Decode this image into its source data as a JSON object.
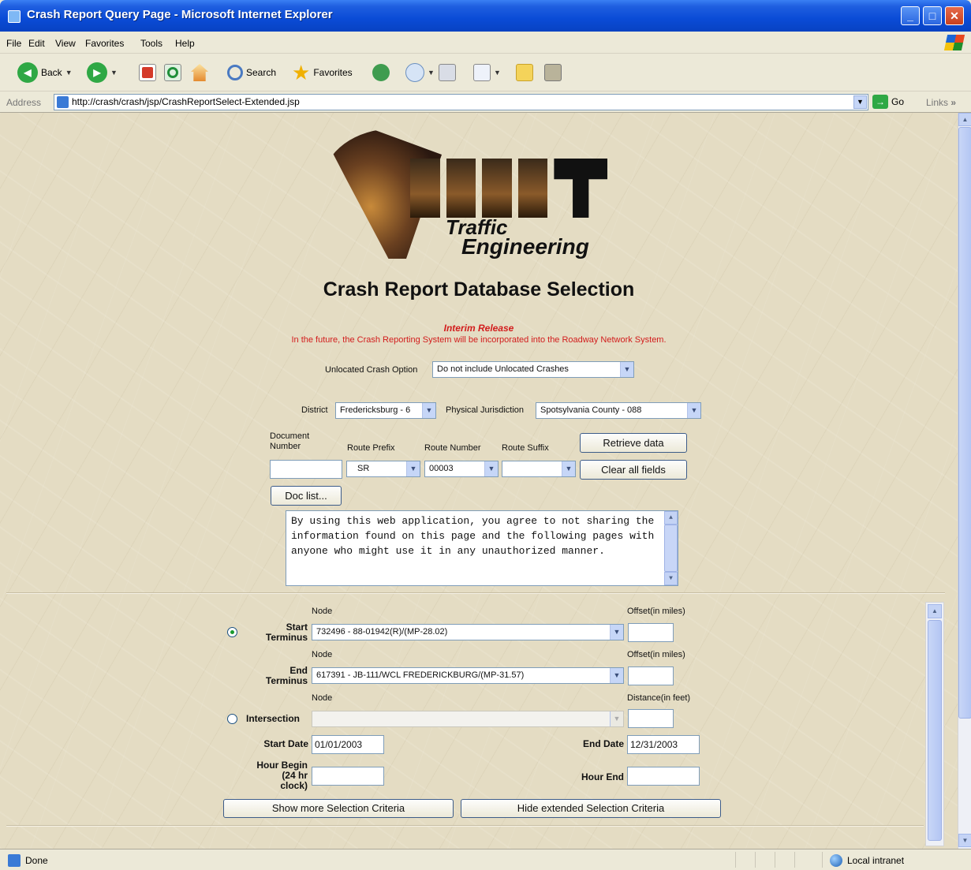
{
  "window": {
    "title": "Crash Report Query Page - Microsoft Internet Explorer",
    "controls": [
      "_",
      "□",
      "✕"
    ]
  },
  "menu": [
    "File",
    "Edit",
    "View",
    "Favorites",
    "Tools",
    "Help"
  ],
  "toolbar": {
    "back_label": "Back",
    "search_label": "Search",
    "favorites_label": "Favorites"
  },
  "address": {
    "label": "Address",
    "url": "http://crash/crash/jsp/CrashReportSelect-Extended.jsp",
    "go_label": "Go",
    "links_label": "Links",
    "more": "»"
  },
  "logo": {
    "line1": "Traffic",
    "line2": "Engineering"
  },
  "page": {
    "title": "Crash Report Database Selection",
    "interim": "Interim Release",
    "notice": "In the future, the Crash Reporting System will be incorporated into the Roadway Network System."
  },
  "unlocated": {
    "label": "Unlocated Crash Option",
    "value": "Do not include Unlocated Crashes"
  },
  "district": {
    "label": "District",
    "value": "Fredericksburg - 6"
  },
  "jurisdiction": {
    "label": "Physical Jurisdiction",
    "value": "Spotsylvania County - 088"
  },
  "route": {
    "document_label": "Document Number",
    "document_value": "",
    "prefix_label": "Route Prefix",
    "prefix_value": "SR",
    "number_label": "Route Number",
    "number_value": "00003",
    "suffix_label": "Route Suffix",
    "suffix_value": ""
  },
  "buttons": {
    "retrieve": "Retrieve data",
    "clear": "Clear all fields",
    "doc_list": "Doc list...",
    "show_more": "Show more Selection Criteria",
    "hide_extended": "Hide extended Selection Criteria"
  },
  "agreement": "By using this web application, you agree to not sharing the information found on this page and the following pages with anyone who might use it in any unauthorized manner.",
  "start_terminus": {
    "node_label": "Node",
    "offset_label": "Offset(in miles)",
    "label_line1": "Start",
    "label_line2": "Terminus",
    "value": "732496 - 88-01942(R)/(MP-28.02)",
    "offset_value": ""
  },
  "end_terminus": {
    "node_label": "Node",
    "offset_label": "Offset(in miles)",
    "label_line1": "End",
    "label_line2": "Terminus",
    "value": "617391 - JB-111/WCL FREDERICKBURG/(MP-31.57)",
    "offset_value": ""
  },
  "intersection": {
    "node_label": "Node",
    "distance_label": "Distance(in feet)",
    "label": "Intersection",
    "value": "",
    "distance_value": ""
  },
  "dates": {
    "start_label": "Start Date",
    "start_value": "01/01/2003",
    "end_label": "End Date",
    "end_value": "12/31/2003"
  },
  "hours": {
    "begin_label_1": "Hour Begin",
    "begin_label_2": "(24 hr",
    "begin_label_3": "clock)",
    "begin_value": "",
    "end_label": "Hour End",
    "end_value": ""
  },
  "status": {
    "text": "Done",
    "zone": "Local intranet"
  }
}
